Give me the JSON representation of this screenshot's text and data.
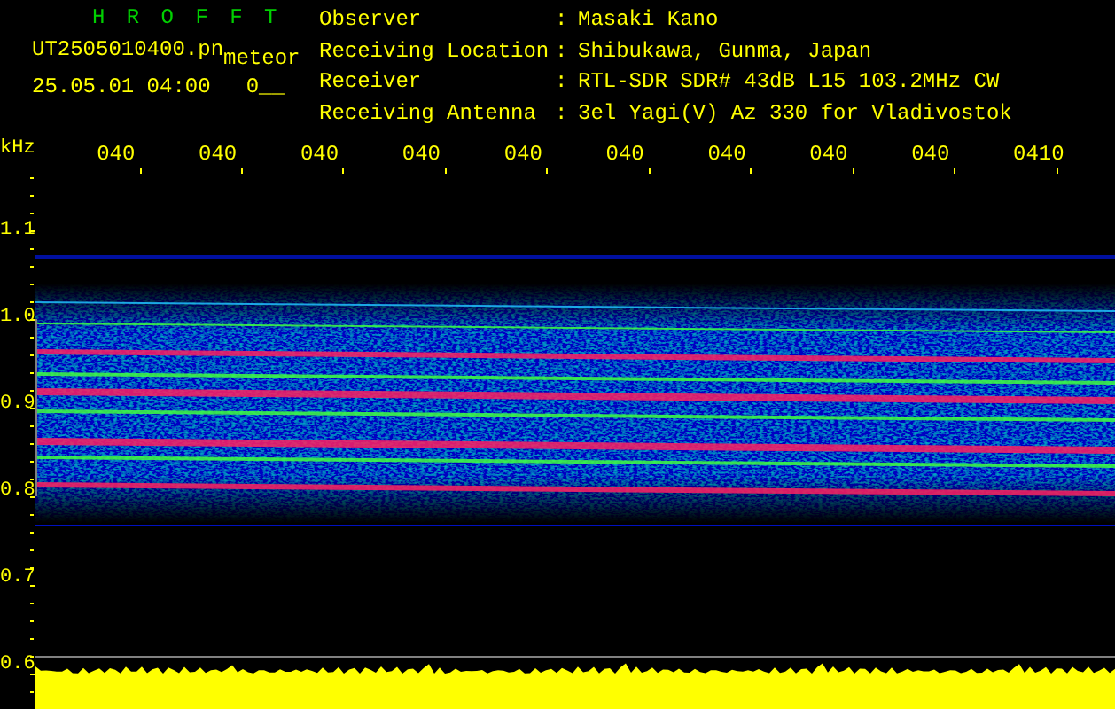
{
  "app": {
    "title": "H R O F F T"
  },
  "file": {
    "name": "UT2505010400.pn",
    "type": "meteor",
    "timestamp": "25.05.01 04:00",
    "count": "0__"
  },
  "station": [
    {
      "label": "Observer",
      "separator": ":",
      "value": "Masaki Kano"
    },
    {
      "label": "Receiving Location",
      "separator": ":",
      "value": "Shibukawa, Gunma, Japan"
    },
    {
      "label": "Receiver",
      "separator": ":",
      "value": "RTL-SDR SDR# 43dB L15 103.2MHz CW"
    },
    {
      "label": "Receiving Antenna",
      "separator": ":",
      "value": "3el Yagi(V) Az 330 for Vladivostok"
    }
  ],
  "axis": {
    "unit": "kHz",
    "time_labels": [
      "040",
      "040",
      "040",
      "040",
      "040",
      "040",
      "040",
      "040",
      "040",
      "0410"
    ],
    "freq_labels": [
      "1.1",
      "1.0",
      "0.9",
      "0.8",
      "0.7",
      "0.6"
    ]
  }
}
